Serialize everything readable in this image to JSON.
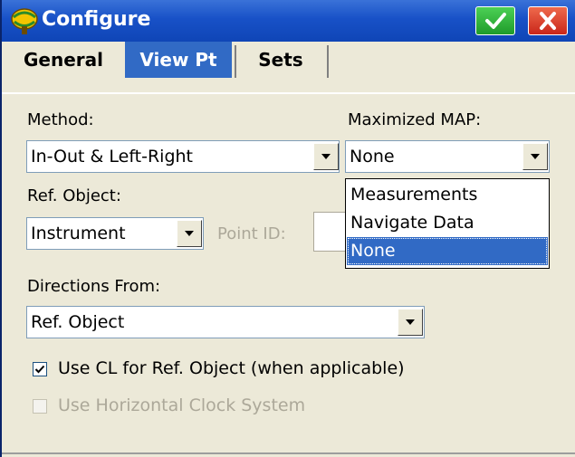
{
  "window": {
    "title": "Configure",
    "icon": "survey-app-icon",
    "ok_icon": "checkmark-icon",
    "close_icon": "close-icon"
  },
  "tabs": [
    {
      "label": "General",
      "selected": false
    },
    {
      "label": "View Pt",
      "selected": true
    },
    {
      "label": "Sets",
      "selected": false
    }
  ],
  "form": {
    "method": {
      "label": "Method:",
      "value": "In-Out & Left-Right"
    },
    "maximized_map": {
      "label": "Maximized MAP:",
      "value": "None",
      "options": [
        "Measurements",
        "Navigate Data",
        "None"
      ],
      "highlighted": "None"
    },
    "ref_object": {
      "label": "Ref. Object:",
      "value": "Instrument"
    },
    "point_id": {
      "label": "Point ID:",
      "value": "",
      "enabled": false
    },
    "directions_from": {
      "label": "Directions From:",
      "value": "Ref. Object"
    },
    "use_cl": {
      "label": "Use CL for Ref. Object (when applicable)",
      "checked": true,
      "enabled": true
    },
    "use_clock": {
      "label": "Use Horizontal Clock System",
      "checked": false,
      "enabled": false
    }
  },
  "colors": {
    "titlebar": "#1851c7",
    "selected_tab": "#316ac5",
    "ok_button": "#1f9b2a",
    "close_button": "#c9261a",
    "dialog_bg": "#ece9d8"
  }
}
